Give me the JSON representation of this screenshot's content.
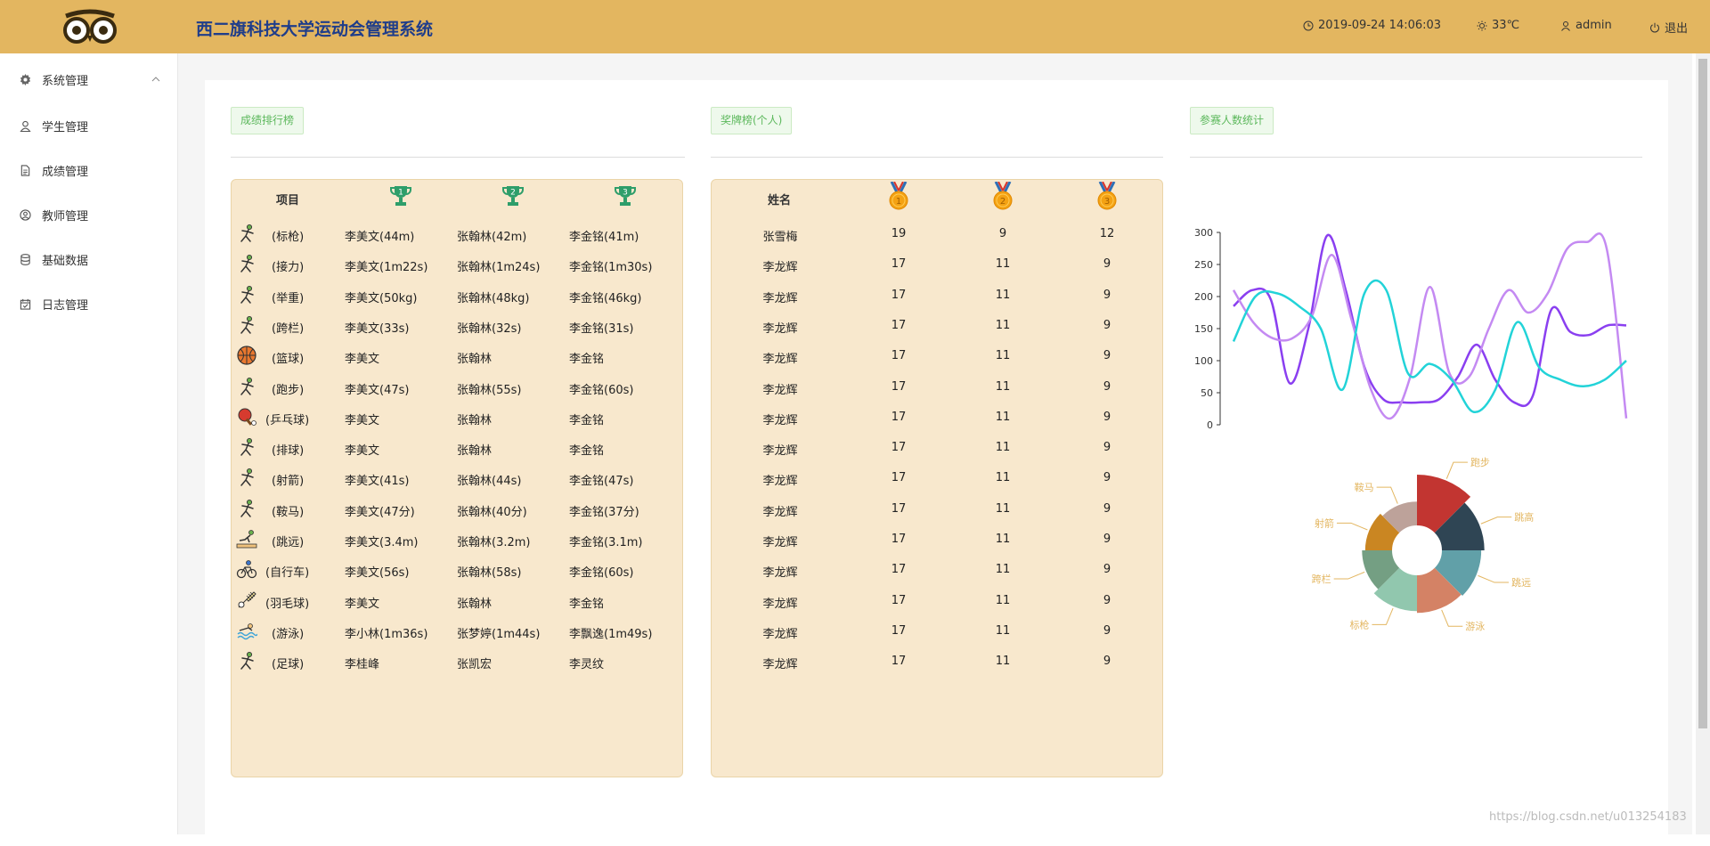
{
  "header": {
    "title": "西二旗科技大学运动会管理系统",
    "datetime": "2019-09-24 14:06:03",
    "weather": "33℃",
    "user": "admin",
    "logout": "退出"
  },
  "sidebar": {
    "items": [
      {
        "label": "系统管理",
        "icon": "gear-icon",
        "expanded": true
      },
      {
        "label": "学生管理",
        "icon": "user-icon"
      },
      {
        "label": "成绩管理",
        "icon": "document-icon"
      },
      {
        "label": "教师管理",
        "icon": "user-circle-icon"
      },
      {
        "label": "基础数据",
        "icon": "database-icon"
      },
      {
        "label": "日志管理",
        "icon": "calendar-icon"
      }
    ]
  },
  "ranking": {
    "tag": "成绩排行榜",
    "header": {
      "event": "项目",
      "ranks": [
        "1",
        "2",
        "3"
      ]
    },
    "rows": [
      {
        "icon": "javelin-icon",
        "event": "(标枪)",
        "first": "李美文(44m)",
        "second": "张翰林(42m)",
        "third": "李金铭(41m)"
      },
      {
        "icon": "relay-icon",
        "event": "(接力)",
        "first": "李美文(1m22s)",
        "second": "张翰林(1m24s)",
        "third": "李金铭(1m30s)"
      },
      {
        "icon": "weightlifting-icon",
        "event": "(举重)",
        "first": "李美文(50kg)",
        "second": "张翰林(48kg)",
        "third": "李金铭(46kg)"
      },
      {
        "icon": "hurdles-icon",
        "event": "(跨栏)",
        "first": "李美文(33s)",
        "second": "张翰林(32s)",
        "third": "李金铭(31s)"
      },
      {
        "icon": "basketball-icon",
        "event": "(篮球)",
        "first": "李美文",
        "second": "张翰林",
        "third": "李金铭"
      },
      {
        "icon": "running-icon",
        "event": "(跑步)",
        "first": "李美文(47s)",
        "second": "张翰林(55s)",
        "third": "李金铭(60s)"
      },
      {
        "icon": "table-tennis-icon",
        "event": "(乒乓球)",
        "first": "李美文",
        "second": "张翰林",
        "third": "李金铭"
      },
      {
        "icon": "volleyball-icon",
        "event": "(排球)",
        "first": "李美文",
        "second": "张翰林",
        "third": "李金铭"
      },
      {
        "icon": "archery-icon",
        "event": "(射箭)",
        "first": "李美文(41s)",
        "second": "张翰林(44s)",
        "third": "李金铭(47s)"
      },
      {
        "icon": "pommel-horse-icon",
        "event": "(鞍马)",
        "first": "李美文(47分)",
        "second": "张翰林(40分)",
        "third": "李金铭(37分)"
      },
      {
        "icon": "long-jump-icon",
        "event": "(跳远)",
        "first": "李美文(3.4m)",
        "second": "张翰林(3.2m)",
        "third": "李金铭(3.1m)"
      },
      {
        "icon": "cycling-icon",
        "event": "(自行车)",
        "first": "李美文(56s)",
        "second": "张翰林(58s)",
        "third": "李金铭(60s)"
      },
      {
        "icon": "badminton-icon",
        "event": "(羽毛球)",
        "first": "李美文",
        "second": "张翰林",
        "third": "李金铭"
      },
      {
        "icon": "swimming-icon",
        "event": "(游泳)",
        "first": "李小林(1m36s)",
        "second": "张梦婷(1m44s)",
        "third": "李飘逸(1m49s)"
      },
      {
        "icon": "football-icon",
        "event": "(足球)",
        "first": "李桂峰",
        "second": "张凯宏",
        "third": "李灵纹"
      }
    ]
  },
  "medals": {
    "tag": "奖牌榜(个人)",
    "header": {
      "name": "姓名",
      "medals": [
        "1",
        "2",
        "3"
      ]
    },
    "rows": [
      {
        "name": "张雪梅",
        "gold": "19",
        "silver": "9",
        "bronze": "12"
      },
      {
        "name": "李龙辉",
        "gold": "17",
        "silver": "11",
        "bronze": "9"
      },
      {
        "name": "李龙辉",
        "gold": "17",
        "silver": "11",
        "bronze": "9"
      },
      {
        "name": "李龙辉",
        "gold": "17",
        "silver": "11",
        "bronze": "9"
      },
      {
        "name": "李龙辉",
        "gold": "17",
        "silver": "11",
        "bronze": "9"
      },
      {
        "name": "李龙辉",
        "gold": "17",
        "silver": "11",
        "bronze": "9"
      },
      {
        "name": "李龙辉",
        "gold": "17",
        "silver": "11",
        "bronze": "9"
      },
      {
        "name": "李龙辉",
        "gold": "17",
        "silver": "11",
        "bronze": "9"
      },
      {
        "name": "李龙辉",
        "gold": "17",
        "silver": "11",
        "bronze": "9"
      },
      {
        "name": "李龙辉",
        "gold": "17",
        "silver": "11",
        "bronze": "9"
      },
      {
        "name": "李龙辉",
        "gold": "17",
        "silver": "11",
        "bronze": "9"
      },
      {
        "name": "李龙辉",
        "gold": "17",
        "silver": "11",
        "bronze": "9"
      },
      {
        "name": "李龙辉",
        "gold": "17",
        "silver": "11",
        "bronze": "9"
      },
      {
        "name": "李龙辉",
        "gold": "17",
        "silver": "11",
        "bronze": "9"
      },
      {
        "name": "李龙辉",
        "gold": "17",
        "silver": "11",
        "bronze": "9"
      }
    ]
  },
  "stats": {
    "tag": "参赛人数统计"
  },
  "chart_data": [
    {
      "type": "line",
      "smooth": true,
      "ylim": [
        0,
        300
      ],
      "yticks": [
        0,
        50,
        100,
        150,
        200,
        250,
        300
      ],
      "series": [
        {
          "color": "#8a3ff0",
          "values": [
            185,
            210,
            195,
            65,
            150,
            295,
            210,
            90,
            40,
            35,
            35,
            40,
            75,
            125,
            70,
            35,
            45,
            180,
            145,
            140,
            155,
            155
          ]
        },
        {
          "color": "#c48af2",
          "values": [
            210,
            160,
            135,
            135,
            170,
            265,
            165,
            55,
            10,
            75,
            215,
            80,
            75,
            150,
            210,
            175,
            205,
            275,
            285,
            275,
            10
          ]
        },
        {
          "color": "#22d3d8",
          "values": [
            130,
            200,
            205,
            185,
            150,
            55,
            205,
            210,
            80,
            95,
            70,
            20,
            55,
            160,
            90,
            70,
            60,
            70,
            100
          ]
        }
      ]
    },
    {
      "type": "pie",
      "variant": "rose-donut",
      "categories": [
        "跑步",
        "跳高",
        "跳远",
        "游泳",
        "标枪",
        "跨栏",
        "射箭",
        "鞍马"
      ],
      "values": [
        100,
        70,
        60,
        55,
        50,
        35,
        28,
        22
      ],
      "colors": [
        "#c23531",
        "#2f4554",
        "#61a0a8",
        "#d48265",
        "#91c7ae",
        "#749f83",
        "#ca8622",
        "#bda29a"
      ],
      "label_color": "#e3b660"
    }
  ],
  "footer": {
    "watermark": "https://blog.csdn.net/u013254183"
  }
}
